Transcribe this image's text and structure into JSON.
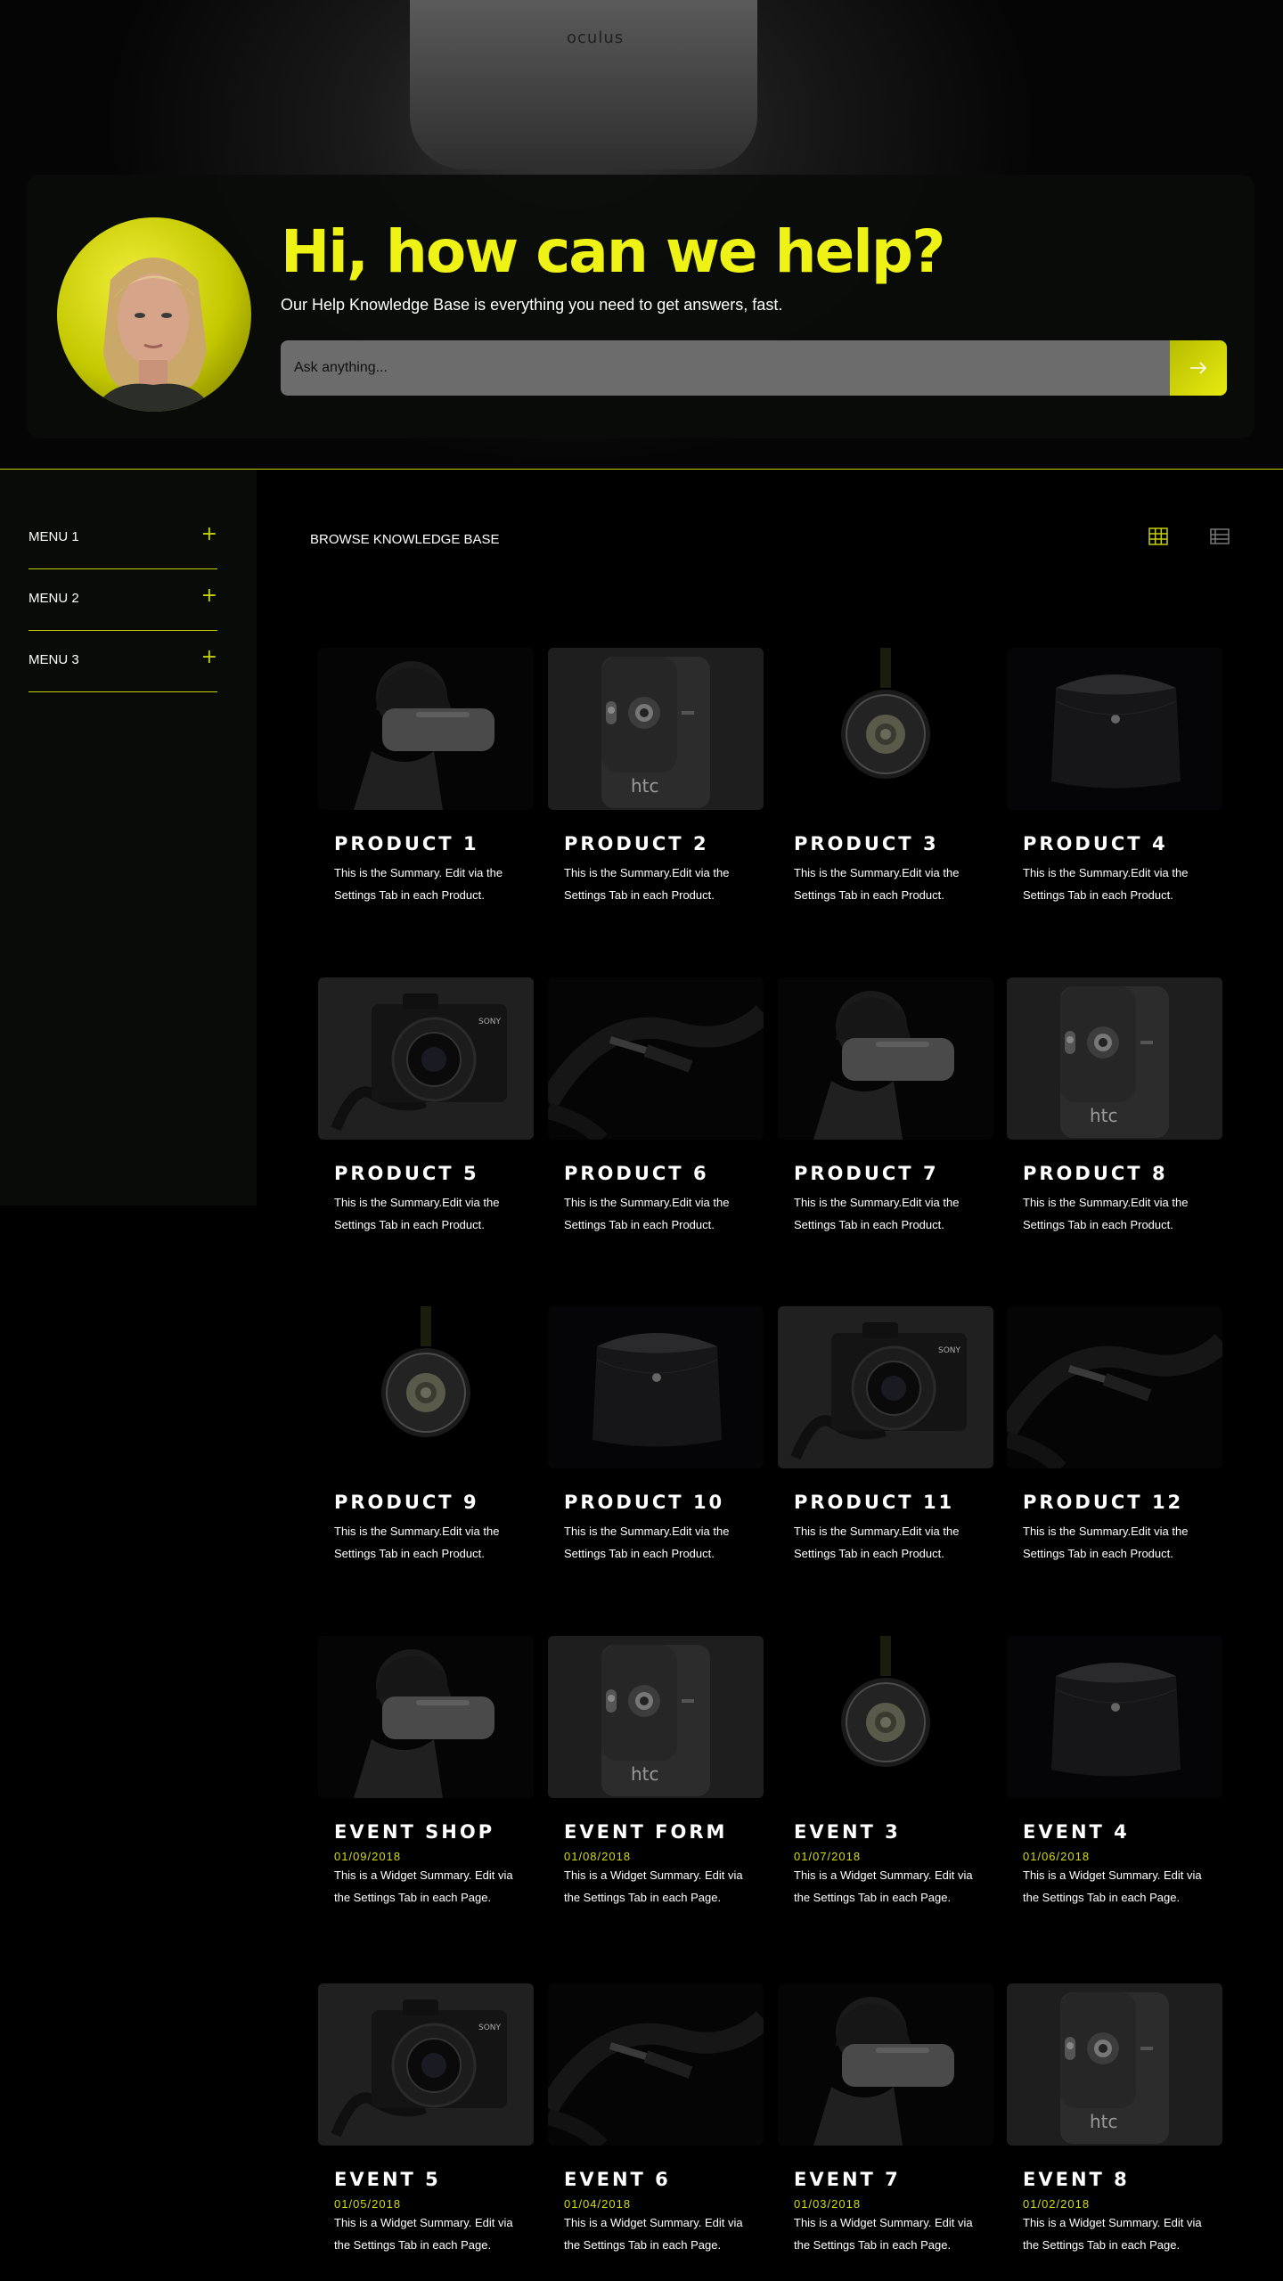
{
  "hero": {
    "bg_label": "oculus",
    "title": "Hi, how can we help?",
    "subtitle": "Our Help Knowledge Base is everything you need to get answers, fast.",
    "search_placeholder": "Ask anything...",
    "search_icon": "arrow-right-icon"
  },
  "colors": {
    "accent": "#c6d10c",
    "title": "#eef215",
    "background": "#000000",
    "card": "#0a0c0a"
  },
  "sidebar": {
    "items": [
      {
        "label": "MENU 1",
        "icon": "plus-icon"
      },
      {
        "label": "MENU 2",
        "icon": "plus-icon"
      },
      {
        "label": "MENU 3",
        "icon": "plus-icon"
      }
    ]
  },
  "main": {
    "heading": "Browse Knowledge Base",
    "view_icons": [
      "grid-view-icon",
      "list-view-icon"
    ],
    "cards": [
      {
        "title": "Product 1",
        "date": "",
        "summary": "This is the Summary. Edit via the Settings Tab in each Product.",
        "image": "vr-headset"
      },
      {
        "title": "Product 2",
        "date": "",
        "summary": "This is the Summary.Edit via the Settings Tab in each Product.",
        "image": "htc-phone"
      },
      {
        "title": "Product 3",
        "date": "",
        "summary": "This is the Summary.Edit via the Settings Tab in each Product.",
        "image": "headphones"
      },
      {
        "title": "Product 4",
        "date": "",
        "summary": "This is the Summary.Edit via the Settings Tab in each Product.",
        "image": "speaker"
      },
      {
        "title": "Product 5",
        "date": "",
        "summary": "This is the Summary.Edit via the Settings Tab in each Product.",
        "image": "camera"
      },
      {
        "title": "Product 6",
        "date": "",
        "summary": "This is the Summary.Edit via the Settings Tab in each Product.",
        "image": "cable"
      },
      {
        "title": "Product 7",
        "date": "",
        "summary": "This is the Summary.Edit via the Settings Tab in each Product.",
        "image": "vr-headset"
      },
      {
        "title": "Product 8",
        "date": "",
        "summary": "This is the Summary.Edit via the Settings Tab in each Product.",
        "image": "htc-phone"
      },
      {
        "title": "Product 9",
        "date": "",
        "summary": "This is the Summary.Edit via the Settings Tab in each Product.",
        "image": "headphones"
      },
      {
        "title": "Product 10",
        "date": "",
        "summary": "This is the Summary.Edit via the Settings Tab in each Product.",
        "image": "speaker"
      },
      {
        "title": "Product 11",
        "date": "",
        "summary": "This is the Summary.Edit via the Settings Tab in each Product.",
        "image": "camera"
      },
      {
        "title": "Product 12",
        "date": "",
        "summary": "This is the Summary.Edit via the Settings Tab in each Product.",
        "image": "cable"
      },
      {
        "title": "Event Shop",
        "date": "01/09/2018",
        "summary": "This is a Widget Summary. Edit via the Settings Tab in each Page.",
        "image": "vr-headset"
      },
      {
        "title": "Event Form",
        "date": "01/08/2018",
        "summary": "This is a Widget Summary. Edit via the Settings Tab in each Page.",
        "image": "htc-phone"
      },
      {
        "title": "Event 3",
        "date": "01/07/2018",
        "summary": "This is a Widget Summary. Edit via the Settings Tab in each Page.",
        "image": "headphones"
      },
      {
        "title": "Event 4",
        "date": "01/06/2018",
        "summary": "This is a Widget Summary. Edit via the Settings Tab in each Page.",
        "image": "speaker"
      },
      {
        "title": "Event 5",
        "date": "01/05/2018",
        "summary": "This is a Widget Summary. Edit via the Settings Tab in each Page.",
        "image": "camera"
      },
      {
        "title": "Event 6",
        "date": "01/04/2018",
        "summary": "This is a Widget Summary. Edit via the Settings Tab in each Page.",
        "image": "cable"
      },
      {
        "title": "Event 7",
        "date": "01/03/2018",
        "summary": "This is a Widget Summary. Edit via the Settings Tab in each Page.",
        "image": "vr-headset"
      },
      {
        "title": "Event 8",
        "date": "01/02/2018",
        "summary": "This is a Widget Summary. Edit via the Settings Tab in each Page.",
        "image": "htc-phone"
      }
    ]
  }
}
